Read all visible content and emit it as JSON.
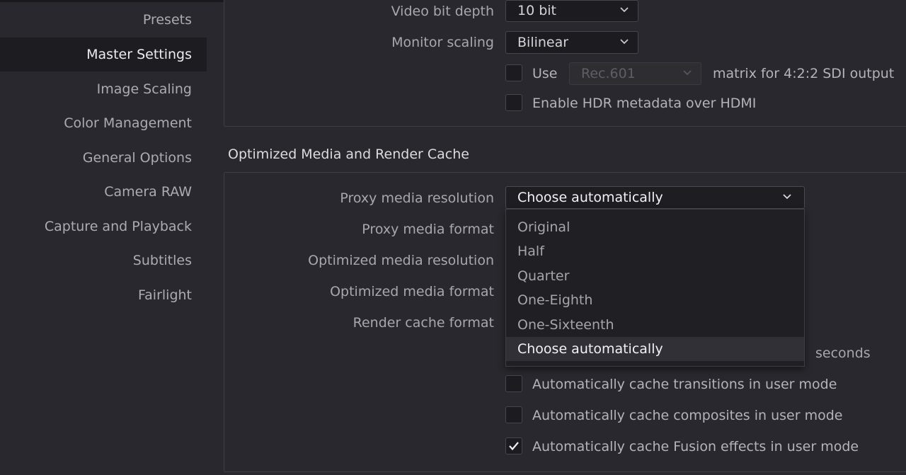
{
  "sidebar": {
    "items": [
      {
        "label": "Presets"
      },
      {
        "label": "Master Settings",
        "active": true
      },
      {
        "label": "Image Scaling"
      },
      {
        "label": "Color Management"
      },
      {
        "label": "General Options"
      },
      {
        "label": "Camera RAW"
      },
      {
        "label": "Capture and Playback"
      },
      {
        "label": "Subtitles"
      },
      {
        "label": "Fairlight"
      }
    ]
  },
  "video_io": {
    "video_bit_depth": {
      "label": "Video bit depth",
      "value": "10 bit"
    },
    "monitor_scaling": {
      "label": "Monitor scaling",
      "value": "Bilinear"
    },
    "use_matrix": {
      "checked": false,
      "prefix": "Use",
      "value": "Rec.601",
      "suffix": "matrix for 4:2:2 SDI output"
    },
    "hdr_metadata": {
      "checked": false,
      "label": "Enable HDR metadata over HDMI"
    }
  },
  "optimized_media": {
    "title": "Optimized Media and Render Cache",
    "proxy_media_resolution": {
      "label": "Proxy media resolution",
      "value": "Choose automatically",
      "options": [
        "Original",
        "Half",
        "Quarter",
        "One-Eighth",
        "One-Sixteenth",
        "Choose automatically"
      ],
      "selected": "Choose automatically"
    },
    "proxy_media_format": {
      "label": "Proxy media format"
    },
    "optimized_media_resolution": {
      "label": "Optimized media resolution"
    },
    "optimized_media_format": {
      "label": "Optimized media format"
    },
    "render_cache_format": {
      "label": "Render cache format"
    },
    "seconds_label": "seconds",
    "cache_transitions": {
      "checked": false,
      "label": "Automatically cache transitions in user mode"
    },
    "cache_composites": {
      "checked": false,
      "label": "Automatically cache composites in user mode"
    },
    "cache_fusion": {
      "checked": true,
      "label": "Automatically cache Fusion effects in user mode"
    }
  },
  "icons": {
    "dropdown": "chevron-down-icon",
    "check": "checkmark-icon"
  },
  "colors": {
    "background": "#28282e",
    "sidebar_active": "#1d1d21",
    "selected_option": "#303036"
  }
}
